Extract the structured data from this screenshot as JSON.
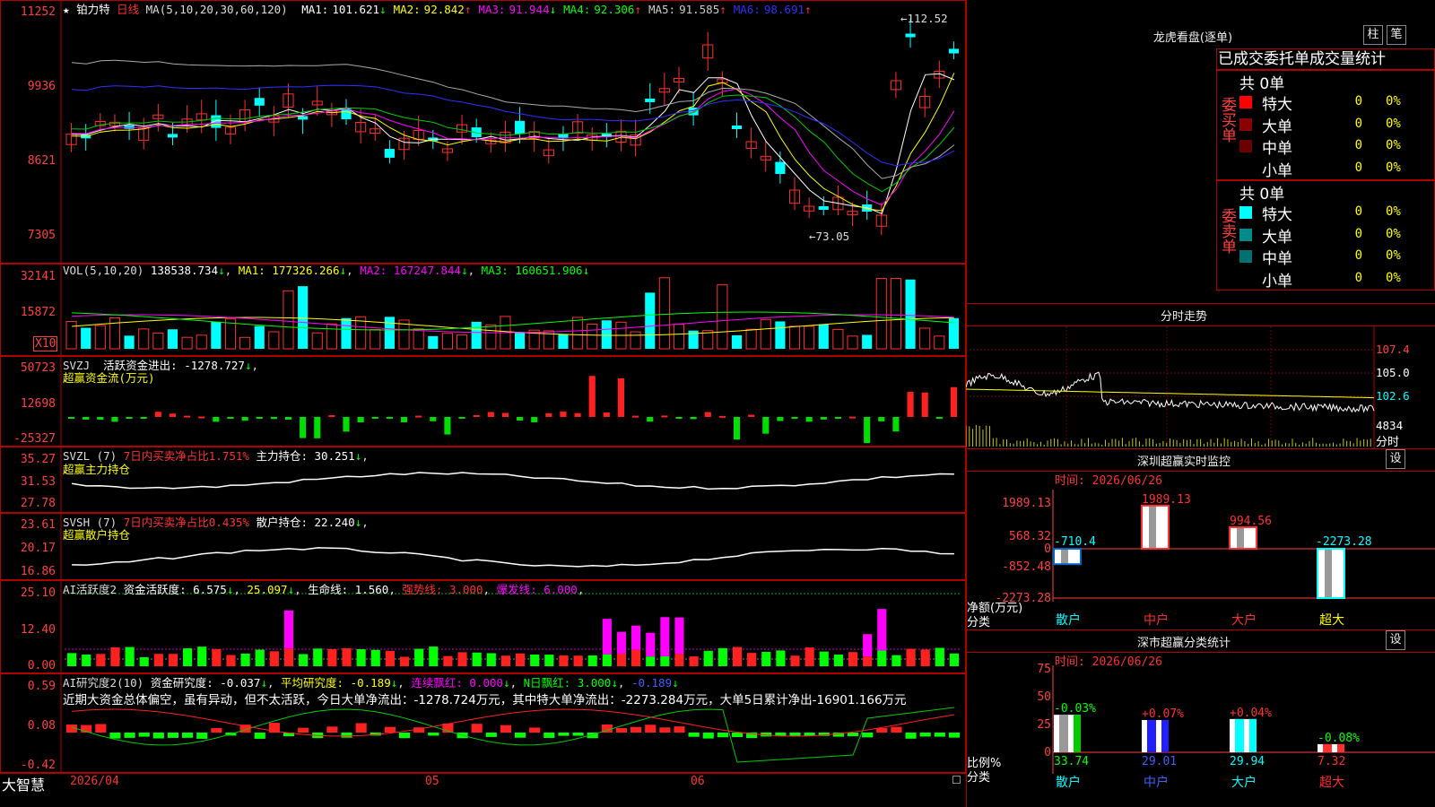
{
  "main_chart": {
    "star_icon": "★",
    "name": "铂力特",
    "period": "日线",
    "ma_params": "MA(5,10,20,30,60,120)",
    "ma": [
      {
        "label": "MA1:",
        "value": "101.621",
        "arrow": "↓",
        "color": "#ffffff"
      },
      {
        "label": "MA2:",
        "value": "92.842",
        "arrow": "↑",
        "color": "#ffff00"
      },
      {
        "label": "MA3:",
        "value": "91.944",
        "arrow": "↓",
        "color": "#ff00ff"
      },
      {
        "label": "MA4:",
        "value": "92.306",
        "arrow": "↑",
        "color": "#00ff00"
      },
      {
        "label": "MA5:",
        "value": "91.585",
        "arrow": "↑",
        "color": "#cccccc"
      },
      {
        "label": "MA6:",
        "value": "98.691",
        "arrow": "↑",
        "color": "#3030ff"
      }
    ],
    "y_ticks": [
      "11252",
      "9936",
      "8621",
      "7305"
    ],
    "high_label": "112.52",
    "low_label": "73.05"
  },
  "volume_panel": {
    "params": "VOL(5,10,20)",
    "value": "138538.734",
    "ma1": "MA1: 177326.266",
    "ma2": "MA2: 167247.844",
    "ma3": "MA3: 160651.906",
    "y_ticks": [
      "32141",
      "15872"
    ],
    "unit": "X10"
  },
  "svzj_panel": {
    "name": "SVZJ",
    "line1": "活跃资金进出: -1278.727",
    "line2": "超赢资金流(万元)",
    "y_ticks": [
      "50723",
      "12698",
      "-25327"
    ]
  },
  "svzl_panel": {
    "name": "SVZL (7)",
    "ratio": "7日内买卖净占比1.751%",
    "holding": "主力持仓: 30.251",
    "line2": "超赢主力持仓",
    "y_ticks": [
      "35.27",
      "31.53",
      "27.78"
    ]
  },
  "svsh_panel": {
    "name": "SVSH (7)",
    "ratio": "7日内买卖净占比0.435%",
    "holding": "散户持仓: 22.240",
    "line2": "超赢散户持仓",
    "y_ticks": [
      "23.61",
      "20.17",
      "16.86"
    ]
  },
  "ai_active_panel": {
    "name": "AI活跃度2",
    "activity": "资金活跃度: 6.575",
    "value2": "25.097",
    "life": "生命线: 1.560",
    "strong": "强势线: 3.000",
    "burst": "爆发线: 6.000",
    "y_ticks": [
      "25.10",
      "12.40",
      "0.00"
    ]
  },
  "ai_research_panel": {
    "name": "AI研究度2(10)",
    "research": "资金研究度: -0.037",
    "avg": "平均研究度: -0.189",
    "consec": "连续飘红: 0.000",
    "nday": "N日飘红: 3.000",
    "last": "-0.189",
    "summary": "近期大资金总体偏空，虽有异动，但不太活跃，今日大单净流出：-1278.724万元，其中特大单净流出：-2273.284万元，大单5日累计净出-16901.166万元",
    "y_ticks": [
      "0.59",
      "0.08",
      "-0.42"
    ]
  },
  "bottom_bar": {
    "logo": "大智慧",
    "date_label": "2026/04",
    "month_05": "05",
    "month_06": "06"
  },
  "dragon_tiger": {
    "title": "龙虎看盘(逐单)",
    "btn_bar": "柱",
    "btn_pen": "笔",
    "tabs": "已成交委托单成交量统计",
    "buy_label": "委买单",
    "sell_label": "委卖单",
    "buy_total": "共 0单",
    "sell_total": "共 0单",
    "buy_rows": [
      {
        "name": "特大",
        "count": "0",
        "pct": "0%",
        "color": "#ff0000"
      },
      {
        "name": "大单",
        "count": "0",
        "pct": "0%",
        "color": "#8b0000"
      },
      {
        "name": "中单",
        "count": "0",
        "pct": "0%",
        "color": "#6b0000"
      },
      {
        "name": "小单",
        "count": "0",
        "pct": "0%",
        "color": "#000000"
      }
    ],
    "sell_rows": [
      {
        "name": "特大",
        "count": "0",
        "pct": "0%",
        "color": "#00ffff"
      },
      {
        "name": "大单",
        "count": "0",
        "pct": "0%",
        "color": "#008b8b"
      },
      {
        "name": "中单",
        "count": "0",
        "pct": "0%",
        "color": "#007070"
      },
      {
        "name": "小单",
        "count": "0",
        "pct": "0%",
        "color": "#000000"
      }
    ]
  },
  "intraday": {
    "title": "分时走势",
    "y_ticks": [
      "107.4",
      "105.0",
      "102.6"
    ],
    "vol_tick": "4834",
    "vol_unit": "分时"
  },
  "sz_monitor": {
    "title": "深圳超赢实时监控",
    "set_btn": "设",
    "time": "时间: 2026/06/26",
    "y_ticks": [
      "1989.13",
      "568.32",
      "0",
      "-852.48",
      "-2273.28"
    ],
    "unit_label": "净额(万元)",
    "cat_label": "分类",
    "categories": [
      "散户",
      "中户",
      "大户",
      "超大"
    ],
    "values": [
      "-710.4",
      "1989.13",
      "994.56",
      "-2273.28"
    ]
  },
  "sz_classify": {
    "title": "深市超赢分类统计",
    "set_btn": "设",
    "time": "时间: 2026/06/26",
    "y_ticks": [
      "75",
      "50",
      "25",
      "0"
    ],
    "ratio_label": "比例%",
    "cat_label": "分类",
    "categories": [
      "散户",
      "中户",
      "大户",
      "超大"
    ],
    "values": [
      "33.74",
      "29.01",
      "29.94",
      "7.32"
    ],
    "changes": [
      "-0.03%",
      "+0.07%",
      "+0.04%",
      "-0.08%"
    ]
  }
}
